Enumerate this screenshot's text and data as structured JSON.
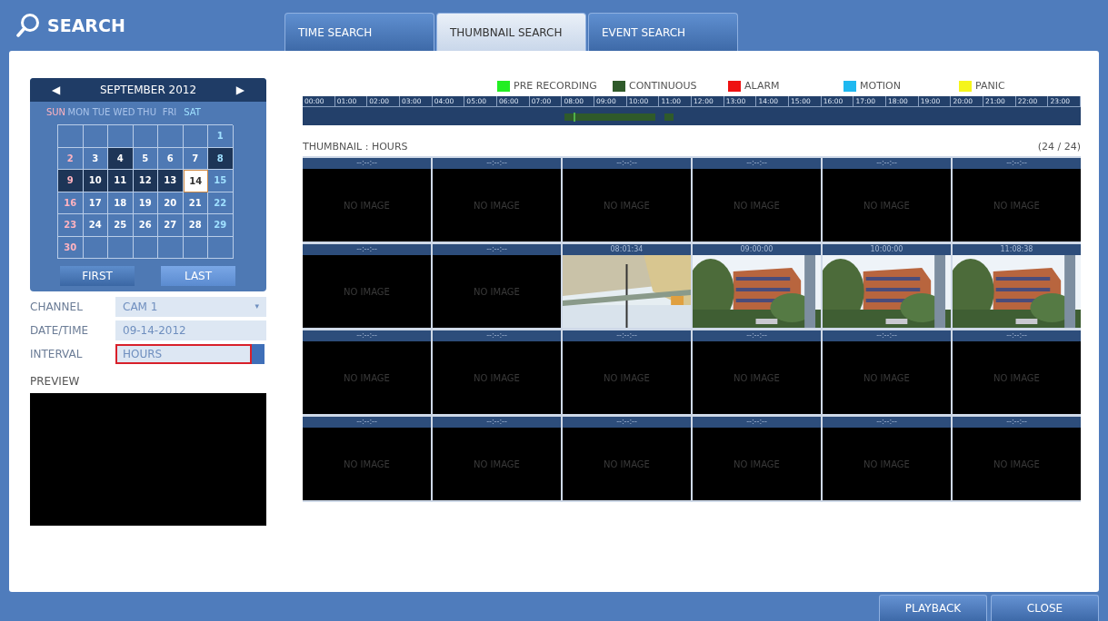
{
  "title": "SEARCH",
  "tabs": [
    {
      "label": "TIME SEARCH",
      "selected": false
    },
    {
      "label": "THUMBNAIL SEARCH",
      "selected": true
    },
    {
      "label": "EVENT SEARCH",
      "selected": false
    }
  ],
  "calendar": {
    "prev": "◀",
    "next": "▶",
    "month": "SEPTEMBER 2012",
    "weekdays": [
      "SUN",
      "MON",
      "TUE",
      "WED",
      "THU",
      "FRI",
      "SAT"
    ],
    "weeks": [
      [
        {
          "day": "1",
          "recorded": false,
          "selected": false
        }
      ],
      [
        {
          "day": "2",
          "recorded": false,
          "selected": false
        },
        {
          "day": "3",
          "recorded": false,
          "selected": false
        },
        {
          "day": "4",
          "recorded": true,
          "selected": false
        },
        {
          "day": "5",
          "recorded": false,
          "selected": false
        },
        {
          "day": "6",
          "recorded": false,
          "selected": false
        },
        {
          "day": "7",
          "recorded": false,
          "selected": false
        },
        {
          "day": "8",
          "recorded": true,
          "selected": false
        }
      ],
      [
        {
          "day": "9",
          "recorded": true,
          "selected": false
        },
        {
          "day": "10",
          "recorded": true,
          "selected": false
        },
        {
          "day": "11",
          "recorded": true,
          "selected": false
        },
        {
          "day": "12",
          "recorded": true,
          "selected": false
        },
        {
          "day": "13",
          "recorded": true,
          "selected": false
        },
        {
          "day": "14",
          "recorded": true,
          "selected": true
        },
        {
          "day": "15",
          "recorded": false,
          "selected": false
        }
      ],
      [
        {
          "day": "16",
          "recorded": false,
          "selected": false
        },
        {
          "day": "17",
          "recorded": false,
          "selected": false
        },
        {
          "day": "18",
          "recorded": false,
          "selected": false
        },
        {
          "day": "19",
          "recorded": false,
          "selected": false
        },
        {
          "day": "20",
          "recorded": false,
          "selected": false
        },
        {
          "day": "21",
          "recorded": false,
          "selected": false
        },
        {
          "day": "22",
          "recorded": false,
          "selected": false
        }
      ],
      [
        {
          "day": "23",
          "recorded": false,
          "selected": false
        },
        {
          "day": "24",
          "recorded": false,
          "selected": false
        },
        {
          "day": "25",
          "recorded": false,
          "selected": false
        },
        {
          "day": "26",
          "recorded": false,
          "selected": false
        },
        {
          "day": "27",
          "recorded": false,
          "selected": false
        },
        {
          "day": "28",
          "recorded": false,
          "selected": false
        },
        {
          "day": "29",
          "recorded": false,
          "selected": false
        }
      ],
      [
        {
          "day": "30",
          "recorded": false,
          "selected": false
        }
      ]
    ],
    "buttons": [
      "FIRST",
      "LAST"
    ]
  },
  "fields": [
    {
      "label": "CHANNEL",
      "value": "CAM 1",
      "kind": "dropdown",
      "highlighted": false,
      "caret": "▾"
    },
    {
      "label": "DATE/TIME",
      "value": "09-14-2012",
      "kind": "text",
      "highlighted": false
    },
    {
      "label": "INTERVAL",
      "value": "HOURS",
      "kind": "dropdown",
      "highlighted": true
    }
  ],
  "preview": {
    "label": "PREVIEW"
  },
  "legend": [
    {
      "label": "PRE RECORDING",
      "color": "#22ee22"
    },
    {
      "label": "CONTINUOUS",
      "color": "#2f5a2a"
    },
    {
      "label": "ALARM",
      "color": "#ee1111"
    },
    {
      "label": "MOTION",
      "color": "#1fb8f0"
    },
    {
      "label": "PANIC",
      "color": "#f5f51a"
    }
  ],
  "timeline": {
    "hours": [
      "00:00",
      "01:00",
      "02:00",
      "03:00",
      "04:00",
      "05:00",
      "06:00",
      "07:00",
      "08:00",
      "09:00",
      "10:00",
      "11:00",
      "12:00",
      "13:00",
      "14:00",
      "15:00",
      "16:00",
      "17:00",
      "18:00",
      "19:00",
      "20:00",
      "21:00",
      "22:00",
      "23:00"
    ]
  },
  "thumbnails": {
    "title": "THUMBNAIL : HOURS",
    "count": "(24 / 24)",
    "items": [
      {
        "time": "--:--:--",
        "kind": "empty",
        "text": "NO IMAGE"
      },
      {
        "time": "--:--:--",
        "kind": "empty",
        "text": "NO IMAGE"
      },
      {
        "time": "--:--:--",
        "kind": "empty",
        "text": "NO IMAGE"
      },
      {
        "time": "--:--:--",
        "kind": "empty",
        "text": "NO IMAGE"
      },
      {
        "time": "--:--:--",
        "kind": "empty",
        "text": "NO IMAGE"
      },
      {
        "time": "--:--:--",
        "kind": "empty",
        "text": "NO IMAGE"
      },
      {
        "time": "--:--:--",
        "kind": "empty",
        "text": "NO IMAGE"
      },
      {
        "time": "--:--:--",
        "kind": "empty",
        "text": "NO IMAGE"
      },
      {
        "time": "08:01:34",
        "kind": "picture"
      },
      {
        "time": "09:00:00",
        "kind": "picture"
      },
      {
        "time": "10:00:00",
        "kind": "picture"
      },
      {
        "time": "11:08:38",
        "kind": "picture"
      },
      {
        "time": "--:--:--",
        "kind": "empty",
        "text": "NO IMAGE"
      },
      {
        "time": "--:--:--",
        "kind": "empty",
        "text": "NO IMAGE"
      },
      {
        "time": "--:--:--",
        "kind": "empty",
        "text": "NO IMAGE"
      },
      {
        "time": "--:--:--",
        "kind": "empty",
        "text": "NO IMAGE"
      },
      {
        "time": "--:--:--",
        "kind": "empty",
        "text": "NO IMAGE"
      },
      {
        "time": "--:--:--",
        "kind": "empty",
        "text": "NO IMAGE"
      },
      {
        "time": "--:--:--",
        "kind": "empty",
        "text": "NO IMAGE"
      },
      {
        "time": "--:--:--",
        "kind": "empty",
        "text": "NO IMAGE"
      },
      {
        "time": "--:--:--",
        "kind": "empty",
        "text": "NO IMAGE"
      },
      {
        "time": "--:--:--",
        "kind": "empty",
        "text": "NO IMAGE"
      },
      {
        "time": "--:--:--",
        "kind": "empty",
        "text": "NO IMAGE"
      },
      {
        "time": "--:--:--",
        "kind": "empty",
        "text": "NO IMAGE"
      }
    ]
  },
  "footer_buttons": [
    "PLAYBACK",
    "CLOSE"
  ]
}
